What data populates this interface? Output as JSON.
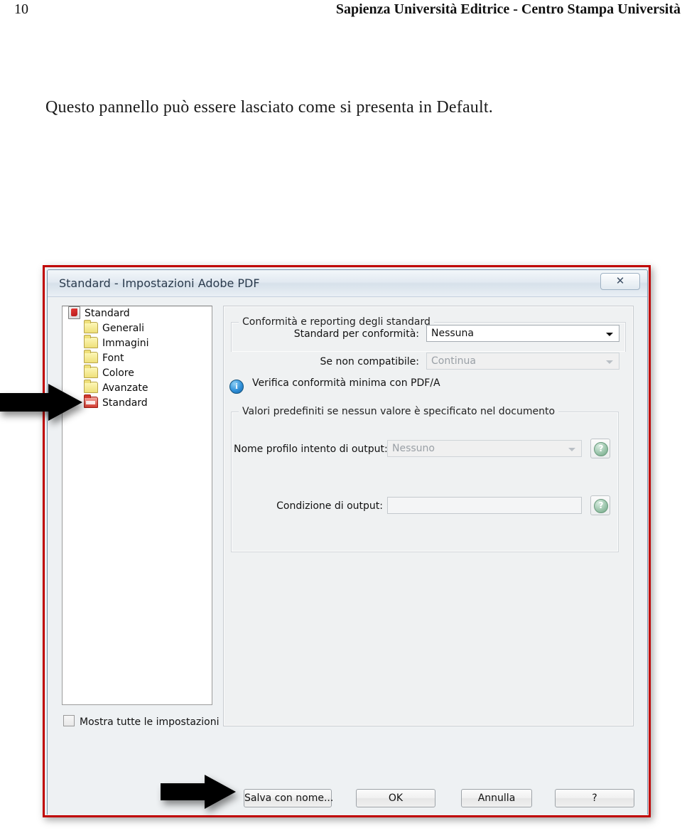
{
  "page": {
    "number": "10",
    "running_head": "Sapienza Università Editrice - Centro Stampa Università",
    "paragraph": "Questo pannello può essere lasciato come si presenta in Default."
  },
  "dialog": {
    "title": "Standard - Impostazioni Adobe PDF",
    "close_label": "✕",
    "sidebar": {
      "items": [
        {
          "label": "Standard",
          "icon": "pdf-document-icon",
          "level": "root",
          "selected": false
        },
        {
          "label": "Generali",
          "icon": "folder-closed-icon",
          "level": "child",
          "selected": false
        },
        {
          "label": "Immagini",
          "icon": "folder-closed-icon",
          "level": "child",
          "selected": false
        },
        {
          "label": "Font",
          "icon": "folder-closed-icon",
          "level": "child",
          "selected": false
        },
        {
          "label": "Colore",
          "icon": "folder-closed-icon",
          "level": "child",
          "selected": false
        },
        {
          "label": "Avanzate",
          "icon": "folder-closed-icon",
          "level": "child",
          "selected": false
        },
        {
          "label": "Standard",
          "icon": "folder-open-red-icon",
          "level": "child",
          "selected": true
        }
      ]
    },
    "show_all_settings": {
      "label": "Mostra tutte le impostazioni",
      "checked": false
    },
    "groups": {
      "conformity": {
        "title": "Conformità e reporting degli standard",
        "standard_label": "Standard per conformità:",
        "standard_value": "Nessuna",
        "noncompliant_label": "Se non compatibile:",
        "noncompliant_value": "Continua",
        "info_text": "Verifica conformità minima con PDF/A",
        "info_icon": "info-icon"
      },
      "defaults": {
        "title": "Valori predefiniti se nessun valore è specificato nel documento",
        "profile_label": "Nome profilo intento di output:",
        "profile_value": "Nessuno",
        "condition_label": "Condizione di output:",
        "condition_value": "",
        "help_icon": "question-mark-icon",
        "help_glyph": "?"
      }
    },
    "buttons": {
      "save_as": "Salva con nome...",
      "ok": "OK",
      "cancel": "Annulla",
      "help": "?"
    }
  },
  "annotations": {
    "arrow_tree": "arrow-right-icon",
    "arrow_saveas": "arrow-right-icon",
    "frame_color": "#c00000"
  }
}
